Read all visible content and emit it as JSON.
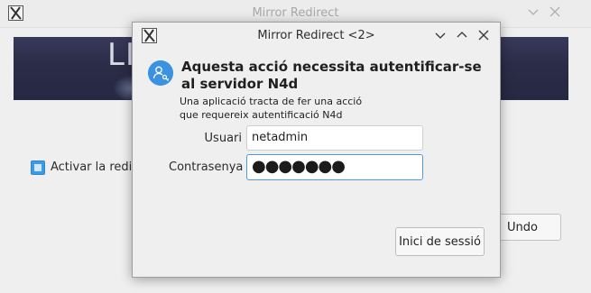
{
  "background_window": {
    "title": "Mirror Redirect",
    "banner_text": "LI",
    "checkbox_label": "Activar la redire",
    "undo_label": "Undo"
  },
  "dialog": {
    "title": "Mirror Redirect <2>",
    "heading": "Aquesta acció necessita autentificar-se al servidor N4d",
    "description_line1": "Una aplicació tracta de fer una acció",
    "description_line2": "que requereix autentificació N4d",
    "user_label": "Usuari",
    "user_value": "netadmin",
    "password_label": "Contrasenya",
    "password_mask": "●●●●●●●",
    "login_button": "Inici de sessió"
  },
  "icons": {
    "app": "x-logo-icon",
    "minimize": "chevron-down-icon",
    "maximize": "chevron-up-icon",
    "close": "close-icon",
    "auth": "user-key-icon"
  },
  "colors": {
    "accent": "#3d9ae8",
    "banner": "#2b2c47"
  }
}
